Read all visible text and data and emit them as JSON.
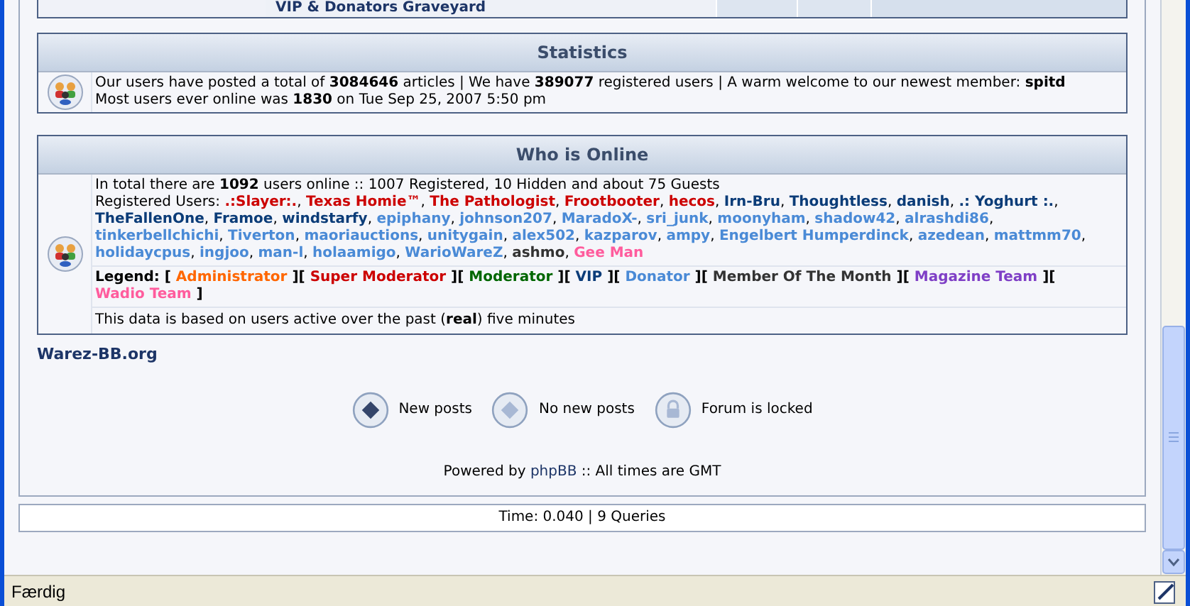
{
  "top_table": {
    "row_label": "VIP & Donators Graveyard"
  },
  "statistics": {
    "title": "Statistics",
    "lines": [
      "Our users have posted a total of **3084646** articles | We have **389077** registered users | A warm welcome to our newest member: **spitd**",
      "Most users ever online was **1830** on Tue Sep 25, 2007 5:50 pm"
    ]
  },
  "who_is_online": {
    "title": "Who is Online",
    "summary": "In total there are **1092** users online :: 1007 Registered, 10 Hidden and about 75 Guests",
    "registered_label": "Registered Users:",
    "users": [
      {
        "name": ".:Slayer:.",
        "color": "#cc0000"
      },
      {
        "name": "Texas Homie™",
        "color": "#cc0000"
      },
      {
        "name": "The Pathologist",
        "color": "#cc0000"
      },
      {
        "name": "Frootbooter",
        "color": "#cc0000"
      },
      {
        "name": "hecos",
        "color": "#cc0000"
      },
      {
        "name": "Irn-Bru",
        "color": "#0b3c78"
      },
      {
        "name": "Thoughtless",
        "color": "#0b3c78"
      },
      {
        "name": "danish",
        "color": "#0b3c78"
      },
      {
        "name": ".: Yoghurt :.",
        "color": "#0b3c78"
      },
      {
        "name": "TheFallenOne",
        "color": "#0b3c78"
      },
      {
        "name": "Framoe",
        "color": "#0b3c78"
      },
      {
        "name": "windstarfy",
        "color": "#0b3c78"
      },
      {
        "name": "epiphany",
        "color": "#4a8ad6"
      },
      {
        "name": "johnson207",
        "color": "#4a8ad6"
      },
      {
        "name": "MaradoX-",
        "color": "#4a8ad6"
      },
      {
        "name": "sri_junk",
        "color": "#4a8ad6"
      },
      {
        "name": "moonyham",
        "color": "#4a8ad6"
      },
      {
        "name": "shadow42",
        "color": "#4a8ad6"
      },
      {
        "name": "alrashdi86",
        "color": "#4a8ad6"
      },
      {
        "name": "tinkerbellchichi",
        "color": "#4a8ad6"
      },
      {
        "name": "Tiverton",
        "color": "#4a8ad6"
      },
      {
        "name": "maoriauctions",
        "color": "#4a8ad6"
      },
      {
        "name": "unitygain",
        "color": "#4a8ad6"
      },
      {
        "name": "alex502",
        "color": "#4a8ad6"
      },
      {
        "name": "kazparov",
        "color": "#4a8ad6"
      },
      {
        "name": "ampy",
        "color": "#4a8ad6"
      },
      {
        "name": "Engelbert Humperdinck",
        "color": "#4a8ad6"
      },
      {
        "name": "azedean",
        "color": "#4a8ad6"
      },
      {
        "name": "mattmm70",
        "color": "#4a8ad6"
      },
      {
        "name": "holidaycpus",
        "color": "#4a8ad6"
      },
      {
        "name": "ingjoo",
        "color": "#4a8ad6"
      },
      {
        "name": "man-l",
        "color": "#4a8ad6"
      },
      {
        "name": "holaamigo",
        "color": "#4a8ad6"
      },
      {
        "name": "WarioWareZ",
        "color": "#4a8ad6"
      },
      {
        "name": "ashmo",
        "color": "#333333"
      },
      {
        "name": "Gee Man",
        "color": "#ff5c9d"
      }
    ],
    "user_separator": ",",
    "legend_label": "Legend:",
    "legend_open": "[",
    "legend_between": "][",
    "legend_close": "]",
    "legend": [
      {
        "name": "Administrator",
        "color": "#ff6600"
      },
      {
        "name": "Super Moderator",
        "color": "#cc0000"
      },
      {
        "name": "Moderator",
        "color": "#006600"
      },
      {
        "name": "VIP",
        "color": "#0b3c78"
      },
      {
        "name": "Donator",
        "color": "#4a8ad6"
      },
      {
        "name": "Member Of The Month",
        "color": "#333333"
      },
      {
        "name": "Magazine Team",
        "color": "#7f3fc6"
      },
      {
        "name": "Wadio Team",
        "color": "#ff5c9d"
      }
    ],
    "footnote": "This data is based on users active over the past (**real**) five minutes"
  },
  "site_name": "Warez-BB.org",
  "icon_legend": [
    {
      "kind": "new",
      "label": "New posts"
    },
    {
      "kind": "none",
      "label": "No new posts"
    },
    {
      "kind": "locked",
      "label": "Forum is locked"
    }
  ],
  "powered": {
    "before": "Powered by",
    "link": "phpBB",
    "after": ":: All times are GMT"
  },
  "timing": "Time: 0.040 | 9 Queries",
  "status_bar": {
    "text": "Færdig"
  }
}
